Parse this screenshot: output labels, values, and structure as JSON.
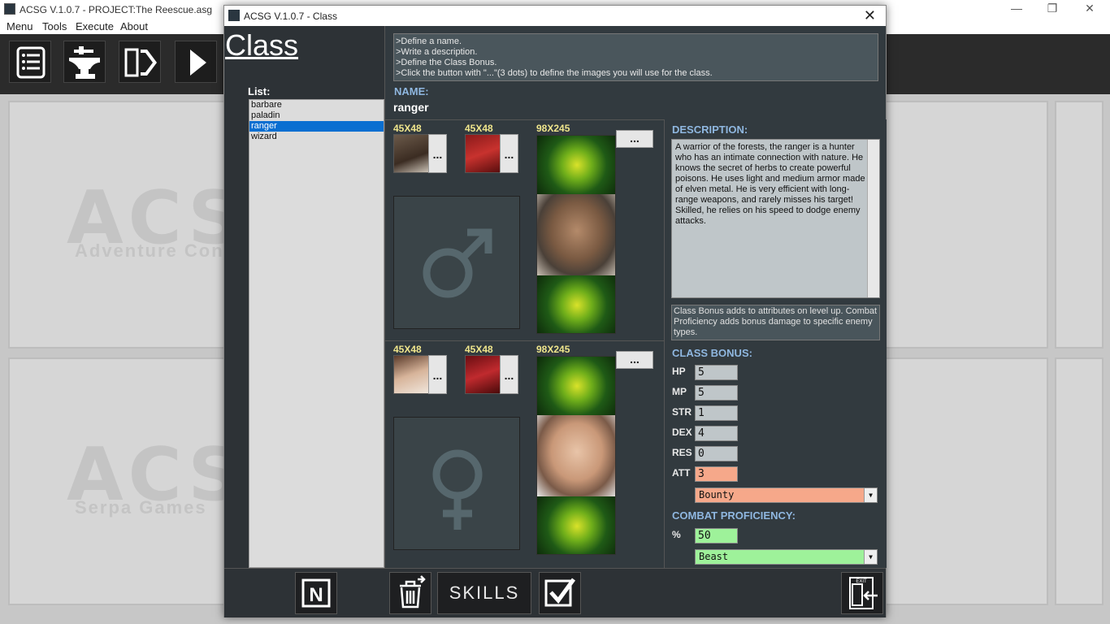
{
  "main_window": {
    "title": "ACSG V.1.0.7 - PROJECT:The Reescue.asg",
    "controls": [
      "—",
      "❐",
      "✕"
    ],
    "menu": [
      "Menu",
      "Tools",
      "Execute",
      "About"
    ],
    "toolbar_icons": [
      "list-icon",
      "anvil-icon",
      "exit-door-icon",
      "play-icon"
    ],
    "bg_logo": "ACSG",
    "bg_sub1": "Adventure Construct",
    "bg_sub2": "Serpa Games"
  },
  "dialog": {
    "title": "ACSG V.1.0.7 - Class",
    "close": "✕",
    "heading": "Class",
    "list_label": "List:",
    "list_items": [
      "barbare",
      "paladin",
      "ranger",
      "wizard"
    ],
    "selected_index": 2,
    "instructions": [
      ">Define a name.",
      ">Write a description.",
      ">Define the Class Bonus.",
      ">Click the button with \"...\"(3 dots) to define the images you will use for the class."
    ],
    "name_label": "NAME:",
    "name_value": "ranger",
    "male": {
      "dim1": "45X48",
      "dim2": "45X48",
      "dim3": "98X245",
      "dots": "..."
    },
    "female": {
      "dim1": "45X48",
      "dim2": "45X48",
      "dim3": "98X245",
      "dots": "..."
    },
    "description_label": "DESCRIPTION:",
    "description": "A warrior of the forests, the ranger is a hunter who has an intimate connection with nature. He knows the secret of herbs to create powerful poisons. He uses light and medium armor made of elven metal. He is very efficient with long-range weapons, and rarely misses his target! Skilled, he relies on his speed to dodge enemy attacks.",
    "note": "Class Bonus adds to attributes on level up. Combat Proficiency adds bonus damage to specific enemy types.",
    "class_bonus_label": "CLASS BONUS:",
    "attributes": [
      {
        "label": "HP",
        "value": "5"
      },
      {
        "label": "MP",
        "value": "5"
      },
      {
        "label": "STR",
        "value": "1"
      },
      {
        "label": "DEX",
        "value": "4"
      },
      {
        "label": "RES",
        "value": "0"
      },
      {
        "label": "ATT",
        "value": "3"
      }
    ],
    "att_type": "Bounty",
    "combat_label": "COMBAT PROFICIENCY:",
    "percent_label": "%",
    "percent_value": "50",
    "enemy_type": "Beast",
    "buttons": {
      "new": "N",
      "skills": "SKILLS",
      "exit": "EXIT"
    },
    "colors": {
      "att_bg": "#f6a88a",
      "bounty_bg": "#f6a88a",
      "percent_bg": "#9ef29a",
      "beast_bg": "#9ef29a",
      "selection": "#0a6fd1",
      "label_blue": "#8fb7e0",
      "dim_yellow": "#f0e68c"
    }
  }
}
